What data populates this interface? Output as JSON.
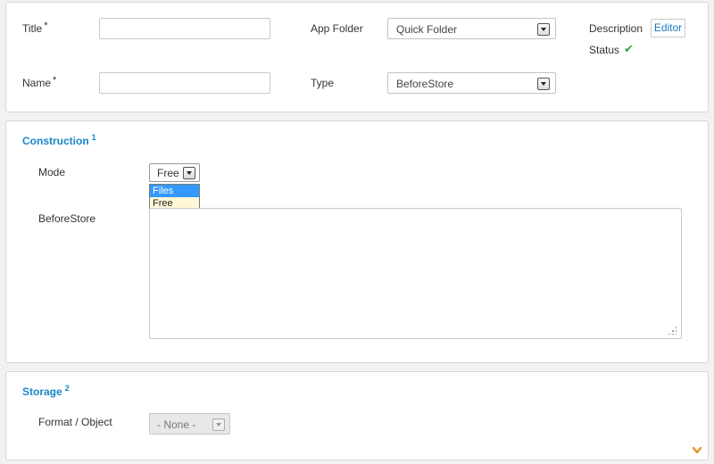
{
  "top": {
    "title_label": "Title",
    "title_required": "*",
    "title_value": "",
    "name_label": "Name",
    "name_required": "*",
    "name_value": "",
    "app_folder_label": "App Folder",
    "app_folder_value": "Quick Folder",
    "type_label": "Type",
    "type_value": "BeforeStore",
    "description_label": "Description",
    "editor_button": "Editor",
    "status_label": "Status",
    "status_icon": "check-icon"
  },
  "construction": {
    "title": "Construction",
    "superscript": "1",
    "mode_label": "Mode",
    "mode_value": "Free",
    "mode_options": [
      "Files",
      "Free"
    ],
    "beforestore_label": "BeforeStore",
    "beforestore_value": ""
  },
  "storage": {
    "title": "Storage",
    "superscript": "2",
    "format_label": "Format / Object",
    "format_value": "- None -",
    "expand_icon": "chevron-down-icon"
  },
  "colors": {
    "accent": "#1a86c8",
    "status_ok": "#3aa536",
    "expand": "#e8902a",
    "dropdown_highlight": "#3399ff"
  }
}
